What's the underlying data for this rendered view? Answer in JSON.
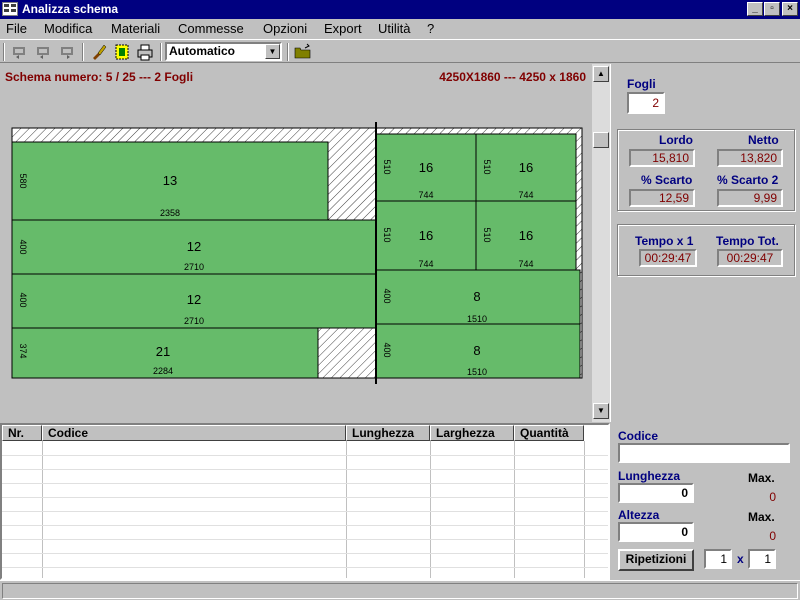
{
  "window": {
    "title": "Analizza schema"
  },
  "menu": [
    "File",
    "Modifica",
    "Materiali",
    "Commesse",
    "Opzioni",
    "Export",
    "Utilità",
    "?"
  ],
  "toolbar": {
    "mode_value": "Automatico"
  },
  "schema": {
    "header": "Schema numero: 5 / 25 --- 2 Fogli",
    "dims": "4250X1860 --- 4250 x 1860",
    "pieces": [
      {
        "code": "13",
        "length": "2358",
        "width": "580"
      },
      {
        "code": "12",
        "length": "2710",
        "width": "400"
      },
      {
        "code": "12",
        "length": "2710",
        "width": "400"
      },
      {
        "code": "21",
        "length": "2284",
        "width": "374"
      },
      {
        "code": "16",
        "length": "744",
        "width": "510"
      },
      {
        "code": "16",
        "length": "744",
        "width": "510"
      },
      {
        "code": "16",
        "length": "744",
        "width": "510"
      },
      {
        "code": "16",
        "length": "744",
        "width": "510"
      },
      {
        "code": "8",
        "length": "1510",
        "width": "400"
      },
      {
        "code": "8",
        "length": "1510",
        "width": "400"
      }
    ]
  },
  "stats": {
    "fogli_label": "Fogli",
    "fogli_value": "2",
    "lordo_label": "Lordo",
    "lordo_value": "15,810",
    "netto_label": "Netto",
    "netto_value": "13,820",
    "scarto_label": "% Scarto",
    "scarto_value": "12,59",
    "scarto2_label": "% Scarto 2",
    "scarto2_value": "9,99",
    "tempo1_label": "Tempo x 1",
    "tempo1_value": "00:29:47",
    "tempotot_label": "Tempo Tot.",
    "tempotot_value": "00:29:47"
  },
  "table": {
    "columns": [
      "Nr.",
      "Codice",
      "Lunghezza",
      "Larghezza",
      "Quantità"
    ]
  },
  "form": {
    "codice_label": "Codice",
    "codice_value": "",
    "lunghezza_label": "Lunghezza",
    "lunghezza_value": "0",
    "altezza_label": "Altezza",
    "altezza_value": "0",
    "max_label": "Max.",
    "max_lunghezza": "0",
    "max_altezza": "0",
    "ripetizioni_label": "Ripetizioni",
    "rip_a": "1",
    "rip_x": "x",
    "rip_b": "1"
  },
  "colors": {
    "piece_green": "#66bb6a",
    "label_blue": "#000080",
    "value_red": "#800000",
    "titlebar": "#000080"
  }
}
